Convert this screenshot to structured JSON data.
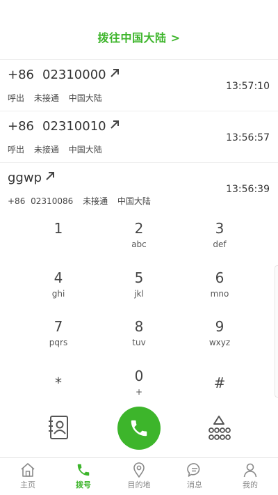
{
  "header": {
    "title": "拨往中国大陆 >"
  },
  "calls": [
    {
      "code": "+86",
      "number": "02310000",
      "name": "",
      "direction": "呼出",
      "status": "未接通",
      "region": "中国大陆",
      "time": "13:57:10"
    },
    {
      "code": "+86",
      "number": "02310010",
      "name": "",
      "direction": "呼出",
      "status": "未接通",
      "region": "中国大陆",
      "time": "13:56:57"
    },
    {
      "name": "ggwp",
      "code": "+86",
      "number": "02310086",
      "status": "未接通",
      "region": "中国大陆",
      "time": "13:56:39"
    }
  ],
  "keypad": {
    "keys": [
      {
        "digit": "1",
        "letters": ""
      },
      {
        "digit": "2",
        "letters": "abc"
      },
      {
        "digit": "3",
        "letters": "def"
      },
      {
        "digit": "4",
        "letters": "ghi"
      },
      {
        "digit": "5",
        "letters": "jkl"
      },
      {
        "digit": "6",
        "letters": "mno"
      },
      {
        "digit": "7",
        "letters": "pqrs"
      },
      {
        "digit": "8",
        "letters": "tuv"
      },
      {
        "digit": "9",
        "letters": "wxyz"
      },
      {
        "digit": "*",
        "letters": ""
      },
      {
        "digit": "0",
        "letters": "+"
      },
      {
        "digit": "#",
        "letters": ""
      }
    ]
  },
  "actions": {
    "contacts_icon": "contacts-book-icon",
    "call_icon": "phone-icon",
    "keypad_icon": "keypad-toggle-icon"
  },
  "bottom_nav": {
    "items": [
      {
        "label": "主页",
        "icon": "home-icon",
        "active": false
      },
      {
        "label": "拨号",
        "icon": "phone-icon",
        "active": true
      },
      {
        "label": "目的地",
        "icon": "location-pin-icon",
        "active": false
      },
      {
        "label": "消息",
        "icon": "chat-bubble-icon",
        "active": false
      },
      {
        "label": "我的",
        "icon": "person-icon",
        "active": false
      }
    ]
  },
  "colors": {
    "accent": "#3db52b",
    "text": "#333333",
    "muted": "#888888"
  }
}
